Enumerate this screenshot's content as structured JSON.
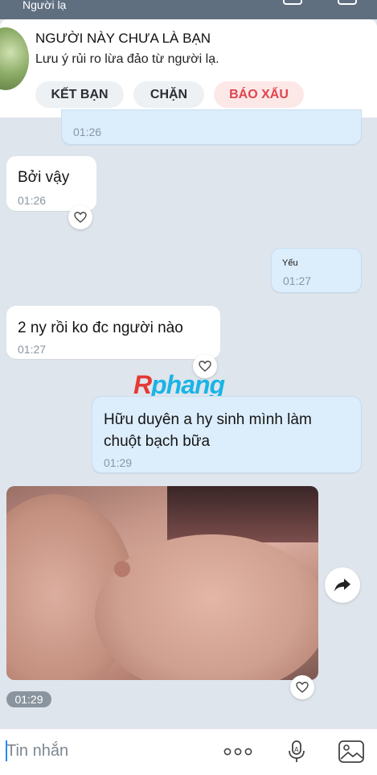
{
  "header": {
    "title": "Người lạ"
  },
  "stranger_banner": {
    "heading": "NGƯỜI NÀY CHƯA LÀ BẠN",
    "warning": "Lưu ý rủi ro lừa đảo từ người lạ.",
    "buttons": {
      "add_friend": "KẾT BẠN",
      "block": "CHẶN",
      "report": "BÁO XẤU"
    }
  },
  "messages": [
    {
      "direction": "out",
      "text": "",
      "time": "01:26"
    },
    {
      "direction": "in",
      "text": "Bởi vậy",
      "time": "01:26"
    },
    {
      "direction": "out",
      "text": "Yếu",
      "time": "01:27"
    },
    {
      "direction": "in",
      "text": "2 ny rồi ko đc người nào",
      "time": "01:27"
    },
    {
      "direction": "out",
      "text": "Hữu duyên a hy sinh mình làm chuột bạch bữa",
      "line1": "Hữu duyên a hy sinh mình làm",
      "line2": "chuột bạch bữa",
      "time": "01:29"
    },
    {
      "direction": "in",
      "type": "photo",
      "time": "01:29"
    }
  ],
  "watermark": {
    "part1": "R",
    "part2": "phang"
  },
  "composer": {
    "placeholder": "Tin nhắn"
  },
  "icons": [
    "heart-icon",
    "share-icon",
    "more-icon",
    "voice-icon",
    "image-icon"
  ],
  "colors": {
    "accent": "#1a8cff",
    "report": "#e0444d",
    "outgoing_bubble": "#dcedfb"
  }
}
